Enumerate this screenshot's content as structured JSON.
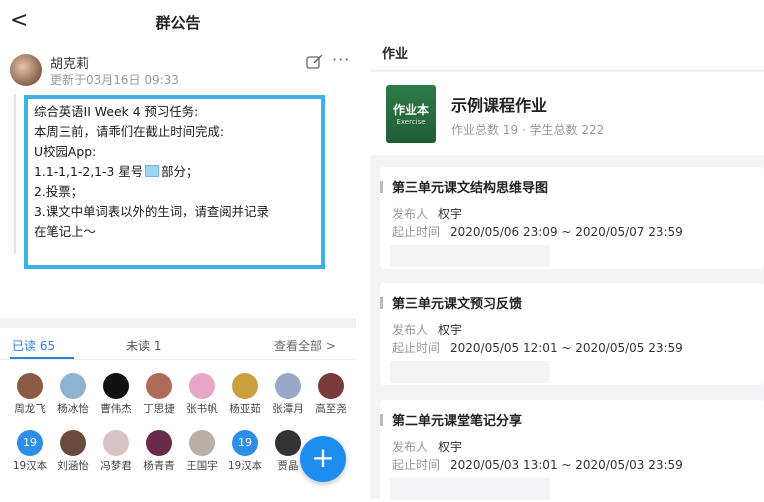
{
  "left": {
    "title": "群公告",
    "back_glyph": "<",
    "poster_name": "胡克莉",
    "poster_time": "更新于03月16日 09:33",
    "more_glyph": "···",
    "notice_lines": [
      "综合英语II Week 4 预习任务:",
      "本周三前，请乖们在截止时间完成:",
      "U校园App:",
      "1.1-1,1-2,1-3 星号",
      "2.投票；",
      "3.课文中单词表以外的生词，请查阅并记录",
      "在笔记上～"
    ],
    "notice_line4_suffix": "部分；",
    "tab_read": "已读 65",
    "tab_unread": "未读 1",
    "tab_all": "查看全部 >",
    "members_row1": [
      {
        "name": "周龙飞",
        "color": "#8a5a44"
      },
      {
        "name": "杨冰怡",
        "color": "#8fb3cf"
      },
      {
        "name": "曹伟杰",
        "color": "#111111"
      },
      {
        "name": "丁思捷",
        "color": "#b06a5a"
      },
      {
        "name": "张书帆",
        "color": "#e8a6c6"
      },
      {
        "name": "杨亚茹",
        "color": "#c9a03c"
      },
      {
        "name": "张潭月",
        "color": "#9aa8c8"
      },
      {
        "name": "高至尧",
        "color": "#7a3b3b"
      }
    ],
    "members_row2": [
      {
        "name": "19汉本",
        "num": "19"
      },
      {
        "name": "刘涵怡",
        "color": "#6a4a3a"
      },
      {
        "name": "冯梦君",
        "color": "#d8c4c4"
      },
      {
        "name": "杨青青",
        "color": "#6a2a4a"
      },
      {
        "name": "王国宇",
        "color": "#b8b0a4"
      },
      {
        "name": "19汉本",
        "num": "19"
      },
      {
        "name": "贾晶",
        "color": "#333333"
      }
    ],
    "fab_glyph": "+"
  },
  "right": {
    "title": "作业",
    "book_label": "作业本",
    "book_sub": "Exercise",
    "course_name": "示例课程作业",
    "course_meta": "作业总数 19 · 学生总数 222",
    "publisher_label": "发布人",
    "period_label": "起止时间",
    "assignments": [
      {
        "title": "第三单元课文结构思维导图",
        "publisher": "权宇",
        "period": "2020/05/06 23:09 ~ 2020/05/07 23:59"
      },
      {
        "title": "第三单元课文预习反馈",
        "publisher": "权宇",
        "period": "2020/05/05 12:01 ~ 2020/05/05 23:59"
      },
      {
        "title": "第二单元课堂笔记分享",
        "publisher": "权宇",
        "period": "2020/05/03 13:01 ~ 2020/05/03 23:59"
      }
    ]
  },
  "colors": {
    "accent": "#2d7fe0",
    "notice_border": "#3db2e6",
    "book_green": "#2f7a48"
  }
}
